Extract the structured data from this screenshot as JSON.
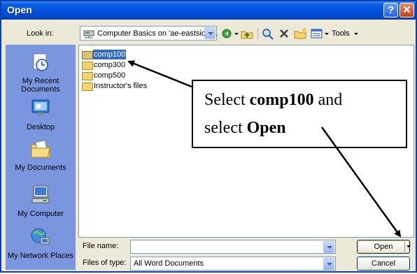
{
  "window": {
    "title": "Open"
  },
  "lookin": {
    "label": "Look in:",
    "value": "Computer Basics on 'ae-eastside'...",
    "tools_label": "Tools"
  },
  "places": [
    {
      "label": "My Recent Documents",
      "icon": "recent-documents-icon"
    },
    {
      "label": "Desktop",
      "icon": "desktop-icon"
    },
    {
      "label": "My Documents",
      "icon": "my-documents-icon"
    },
    {
      "label": "My Computer",
      "icon": "my-computer-icon"
    },
    {
      "label": "My Network Places",
      "icon": "network-places-icon"
    }
  ],
  "files": [
    {
      "name": "comp100",
      "selected": true
    },
    {
      "name": "comp300",
      "selected": false
    },
    {
      "name": "comp500",
      "selected": false
    },
    {
      "name": "Instructor's files",
      "selected": false
    }
  ],
  "filename": {
    "label": "File name:",
    "value": ""
  },
  "filetype": {
    "label": "Files of type:",
    "value": "All Word Documents"
  },
  "buttons": {
    "open": "Open",
    "cancel": "Cancel"
  },
  "callout": {
    "line1_pre": "Select ",
    "line1_bold": "comp100",
    "line1_post": " and",
    "line2_pre": "select ",
    "line2_bold": "Open"
  },
  "colors": {
    "titlebar": "#0053e0",
    "selection": "#316ac5",
    "places_bar": "#7a96df",
    "folder": "#f5d36b"
  }
}
